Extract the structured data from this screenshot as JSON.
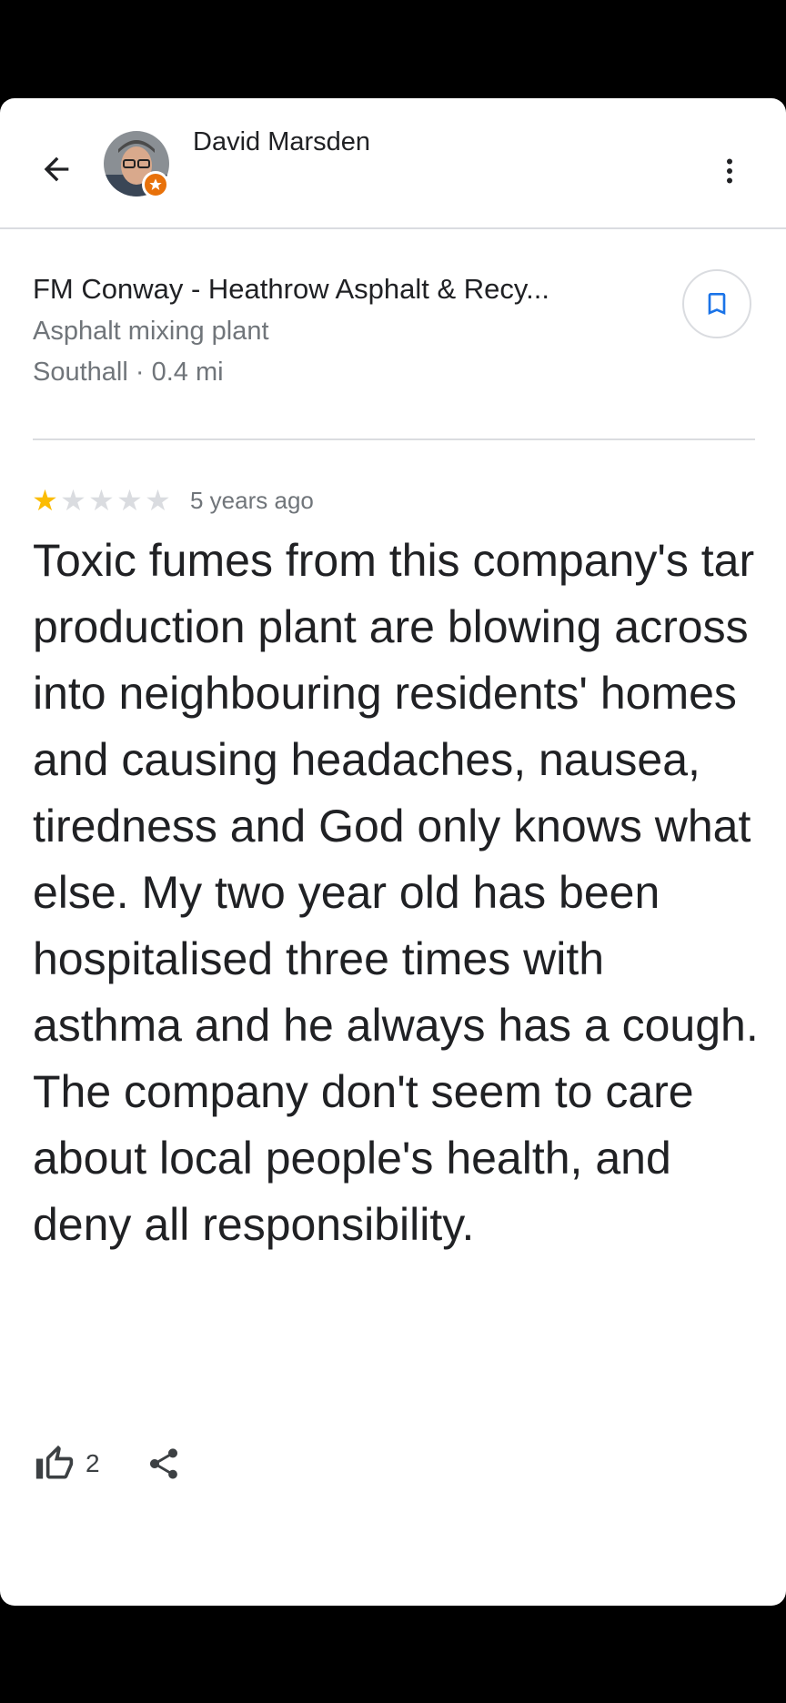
{
  "header": {
    "back_icon": "arrow-back-icon",
    "user_name": "David Marsden",
    "avatar_badge_icon": "local-guide-star-icon",
    "more_icon": "more-vert-icon"
  },
  "place": {
    "name": "FM Conway - Heathrow Asphalt & Recy...",
    "category": "Asphalt mixing plant",
    "location": "Southall · 0.4 mi",
    "save_icon": "bookmark-icon"
  },
  "review": {
    "rating": 1,
    "max_rating": 5,
    "date": "5 years ago",
    "text": "Toxic fumes from this company's tar production plant are blowing across into neighbouring residents' homes and causing headaches, nausea, tiredness and God only knows what else. My two year old has been hospitalised three times with asthma and he always has a cough. The company don't seem to care about local people's health, and deny all responsibility."
  },
  "actions": {
    "like_icon": "thumb-up-icon",
    "like_count": "2",
    "share_icon": "share-icon"
  },
  "colors": {
    "star_filled": "#fbbc04",
    "star_empty": "#dadce0",
    "accent": "#1a73e8",
    "badge": "#e8710a"
  }
}
